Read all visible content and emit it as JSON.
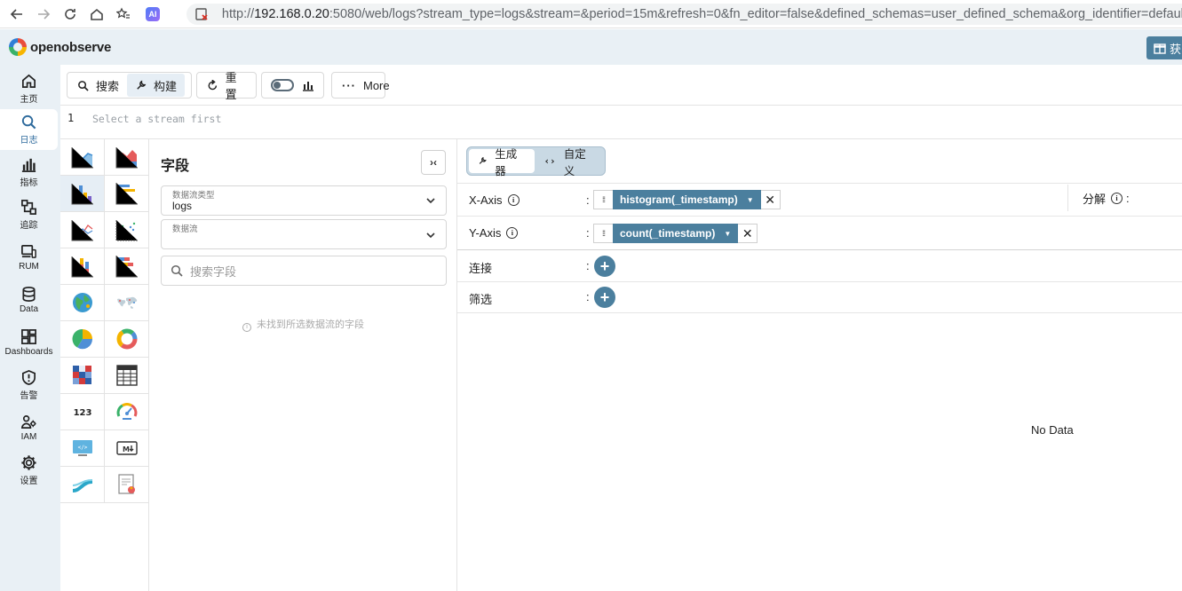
{
  "browser": {
    "url_prefix": "http://",
    "url_host": "192.168.0.20",
    "url_rest": ":5080/web/logs?stream_type=logs&stream=&period=15m&refresh=0&fn_editor=false&defined_schemas=user_defined_schema&org_identifier=default",
    "ai_label": "AI"
  },
  "app": {
    "logo_text": "openobserve",
    "header_button_label": "获"
  },
  "nav": {
    "items": [
      {
        "label": "主页",
        "icon": "home-icon"
      },
      {
        "label": "日志",
        "icon": "search-icon"
      },
      {
        "label": "指标",
        "icon": "bar-chart-icon"
      },
      {
        "label": "追踪",
        "icon": "trace-icon"
      },
      {
        "label": "RUM",
        "icon": "devices-icon"
      },
      {
        "label": "Data",
        "icon": "database-icon"
      },
      {
        "label": "Dashboards",
        "icon": "dashboard-icon"
      },
      {
        "label": "告警",
        "icon": "shield-icon"
      },
      {
        "label": "IAM",
        "icon": "users-icon"
      },
      {
        "label": "设置",
        "icon": "gear-icon"
      }
    ],
    "active_index": 1
  },
  "toolbar": {
    "search_label": "搜索",
    "build_label": "构建",
    "reset_label": "重置",
    "more_label": "More"
  },
  "editor": {
    "line_number": "1",
    "placeholder": "Select a stream first"
  },
  "fields": {
    "title": "字段",
    "stream_type_caption": "数据流类型",
    "stream_type_value": "logs",
    "stream_caption": "数据流",
    "stream_value": "",
    "search_placeholder": "搜索字段",
    "empty_message": "未找到所选数据流的字段"
  },
  "builder": {
    "mode_builder": "生成器",
    "mode_custom": "自定义",
    "x_axis_label": "X-Axis",
    "x_axis_field": "histogram(_timestamp)",
    "y_axis_label": "Y-Axis",
    "y_axis_field": "count(_timestamp)",
    "join_label": "连接",
    "filter_label": "筛选",
    "breakdown_label": "分解",
    "colon": ":",
    "no_data": "No Data"
  },
  "chart_types": {
    "selected_index": 2,
    "items": [
      "area-chart-icon",
      "stacked-area-icon",
      "bar-chart-icon",
      "horizontal-bar-icon",
      "line-chart-icon",
      "scatter-chart-icon",
      "stacked-bar-icon",
      "horizontal-stacked-icon",
      "geo-map-icon",
      "world-map-icon",
      "pie-chart-icon",
      "donut-chart-icon",
      "heatmap-icon",
      "table-icon",
      "metric-number-icon",
      "gauge-icon",
      "html-icon",
      "markdown-icon",
      "sankey-icon",
      "custom-chart-icon"
    ]
  },
  "colors": {
    "accent": "#4b7f9e",
    "nav_bg": "#e9f0f5",
    "active_nav": "#2d6a9c"
  }
}
